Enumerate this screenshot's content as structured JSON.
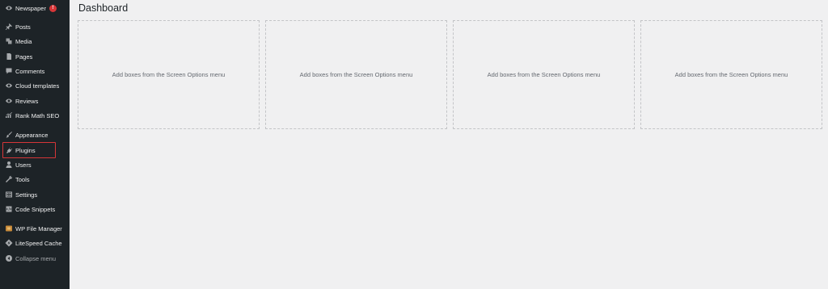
{
  "sidebar": {
    "items": [
      {
        "label": "Newspaper",
        "icon": "newspaper-eye-icon",
        "badge": "!"
      },
      {
        "label": "Posts",
        "icon": "pushpin-icon"
      },
      {
        "label": "Media",
        "icon": "media-icon"
      },
      {
        "label": "Pages",
        "icon": "pages-icon"
      },
      {
        "label": "Comments",
        "icon": "comments-icon"
      },
      {
        "label": "Cloud templates",
        "icon": "cloud-templates-eye-icon"
      },
      {
        "label": "Reviews",
        "icon": "reviews-eye-icon"
      },
      {
        "label": "Rank Math SEO",
        "icon": "rank-math-icon"
      },
      {
        "label": "Appearance",
        "icon": "appearance-brush-icon"
      },
      {
        "label": "Plugins",
        "icon": "plugins-icon"
      },
      {
        "label": "Users",
        "icon": "users-icon"
      },
      {
        "label": "Tools",
        "icon": "tools-wrench-icon"
      },
      {
        "label": "Settings",
        "icon": "settings-icon"
      },
      {
        "label": "Code Snippets",
        "icon": "code-snippets-icon"
      },
      {
        "label": "WP File Manager",
        "icon": "file-manager-icon"
      },
      {
        "label": "LiteSpeed Cache",
        "icon": "litespeed-icon"
      },
      {
        "label": "Collapse menu",
        "icon": "collapse-menu-icon"
      }
    ],
    "highlighted_item": "Plugins",
    "highlight_color": "#d63638"
  },
  "main": {
    "title": "Dashboard",
    "boxes": [
      {
        "text": "Add boxes from the Screen Options menu"
      },
      {
        "text": "Add boxes from the Screen Options menu"
      },
      {
        "text": "Add boxes from the Screen Options menu"
      },
      {
        "text": "Add boxes from the Screen Options menu"
      }
    ]
  },
  "colors": {
    "sidebar_bg": "#1d2327",
    "content_bg": "#f0f0f1",
    "badge": "#d63638"
  }
}
